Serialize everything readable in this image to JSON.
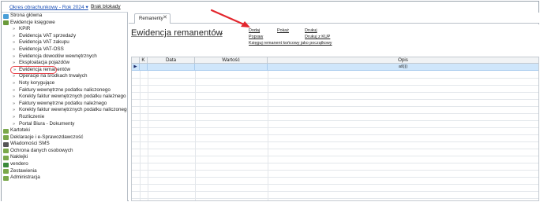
{
  "header": {
    "period": "Okres obrachunkowy - Rok 2024",
    "period_arrow": "▾",
    "lock_status": "Brak blokady"
  },
  "sidebar": {
    "items": [
      {
        "label": "Strona główna",
        "level": "top",
        "icon": "home-icon",
        "icon_color": "#4a9fd8"
      },
      {
        "label": "Ewidencje księgowe",
        "level": "top",
        "icon": "books-icon",
        "icon_color": "#6a9a3a"
      },
      {
        "label": "KPiR",
        "level": "sub"
      },
      {
        "label": "Ewidencja VAT sprzedaży",
        "level": "sub"
      },
      {
        "label": "Ewidencja VAT zakupu",
        "level": "sub"
      },
      {
        "label": "Ewidencja VAT-OSS",
        "level": "sub"
      },
      {
        "label": "Ewidencja dowodów wewnętrznych",
        "level": "sub"
      },
      {
        "label": "Eksploatacja pojazdów",
        "level": "sub"
      },
      {
        "label": "Ewidencja remanentów",
        "level": "sub",
        "active": true
      },
      {
        "label": "Operacje na środkach trwałych",
        "level": "sub"
      },
      {
        "label": "Noty korygujące",
        "level": "sub"
      },
      {
        "label": "Faktury wewnętrzne podatku naliczonego",
        "level": "sub"
      },
      {
        "label": "Korekty faktur wewnętrznych podatku należnego",
        "level": "sub"
      },
      {
        "label": "Faktury wewnętrzne podatku należnego",
        "level": "sub"
      },
      {
        "label": "Korekty faktur wewnętrznych podatku naliczonego",
        "level": "sub"
      },
      {
        "label": "Rozliczenie",
        "level": "sub"
      },
      {
        "label": "Portal Biura - Dokumenty",
        "level": "sub"
      },
      {
        "label": "Kartoteki",
        "level": "top",
        "icon": "folder-icon",
        "icon_color": "#7aa84a"
      },
      {
        "label": "Deklaracje i e-Sprawozdawczość",
        "level": "top",
        "icon": "folder-icon",
        "icon_color": "#7aa84a"
      },
      {
        "label": "Wiadomości SMS",
        "level": "top",
        "icon": "phone-icon",
        "icon_color": "#555555"
      },
      {
        "label": "Ochrona danych osobowych",
        "level": "top",
        "icon": "folder-icon",
        "icon_color": "#7aa84a"
      },
      {
        "label": "Naklejki",
        "level": "top",
        "icon": "folder-icon",
        "icon_color": "#7aa84a"
      },
      {
        "label": "vendero",
        "level": "top",
        "icon": "vendero-icon",
        "icon_color": "#3a8a3a"
      },
      {
        "label": "Zestawienia",
        "level": "top",
        "icon": "folder-icon",
        "icon_color": "#7aa84a"
      },
      {
        "label": "Administracja",
        "level": "top",
        "icon": "gear-icon",
        "icon_color": "#7aa84a"
      }
    ]
  },
  "tabs": [
    {
      "label": "Remanenty",
      "close": "✕"
    }
  ],
  "main": {
    "title": "Ewidencja remanentów",
    "title_arrow": "▾",
    "actions": {
      "add": "Dodaj",
      "show": "Pokaż",
      "print": "Drukuj",
      "edit": "Popraw",
      "print_kup": "Drukuj z KUP",
      "book_closing": "Księguj remanent końcowy jako początkowy"
    }
  },
  "grid": {
    "columns": [
      "",
      "K",
      "Data",
      "Wartość",
      "Opis"
    ],
    "rows": [
      {
        "marker": "▶",
        "k": "",
        "data": "",
        "wartosc": "",
        "opis": "aš)))"
      }
    ]
  },
  "colors": {
    "accent_link": "#1a4fb5",
    "selected_row": "#cfe6fb",
    "highlight": "#e8464d"
  }
}
